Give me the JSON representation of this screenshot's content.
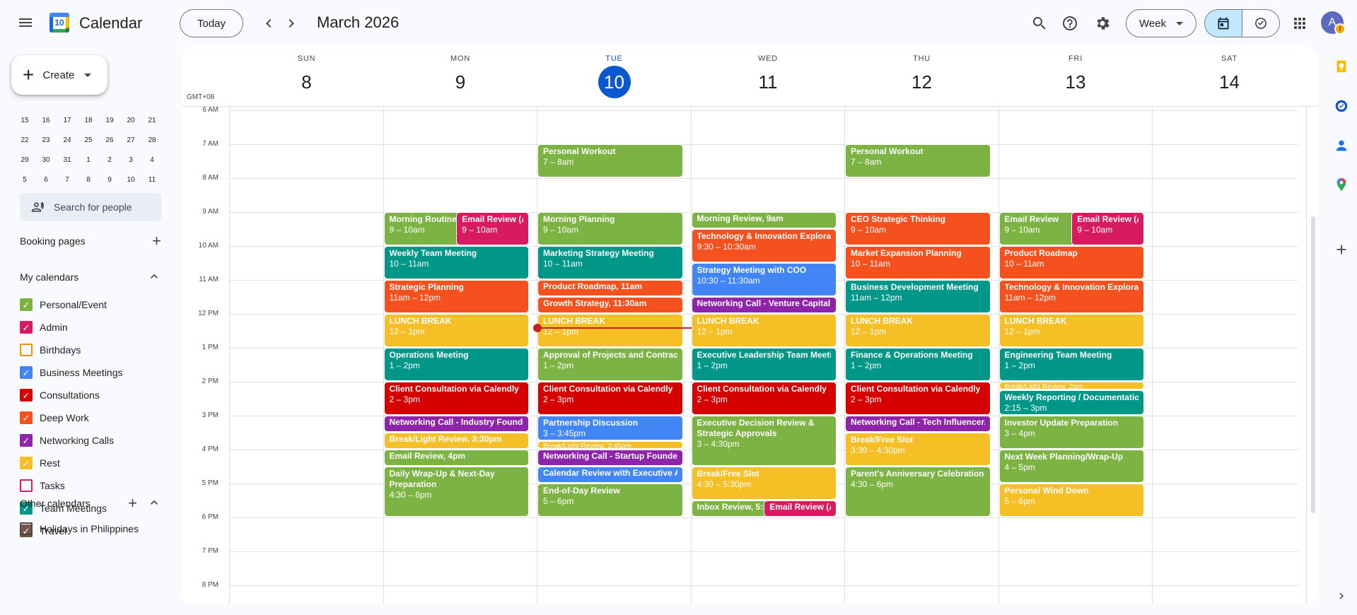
{
  "colors": {
    "lavender": "#7986cb",
    "green": "#7cb342",
    "teal": "#039be5",
    "peacock": "#0b8043",
    "tomato": "#d50000",
    "tangerine": "#f4511e",
    "grape": "#8e24aa",
    "banana": "#f6bf26",
    "flamingo": "#d81b60",
    "blueberry": "#3f86f5",
    "basil": "#0d9488",
    "graphite": "#795548",
    "now": "#c5221f",
    "today": "#0b57d0"
  },
  "header": {
    "menu_icon": "menu-icon",
    "logo_date": "10",
    "app_title": "Calendar",
    "today_label": "Today",
    "prev_icon": "chevron-left-icon",
    "next_icon": "chevron-right-icon",
    "month_title": "March 2026",
    "view_label": "Week",
    "avatar_letter": "A",
    "avatar_badge": "!"
  },
  "sidebar": {
    "create_label": "Create",
    "minical_rows": [
      [
        "15",
        "16",
        "17",
        "18",
        "19",
        "20",
        "21"
      ],
      [
        "22",
        "23",
        "24",
        "25",
        "26",
        "27",
        "28"
      ],
      [
        "29",
        "30",
        "31",
        "1",
        "2",
        "3",
        "4"
      ],
      [
        "5",
        "6",
        "7",
        "8",
        "9",
        "10",
        "11"
      ]
    ],
    "people_search_placeholder": "Search for people",
    "booking_pages_label": "Booking pages",
    "my_calendars_label": "My calendars",
    "my_calendars": [
      {
        "label": "Personal/Event",
        "color": "#7cb342",
        "checked": true
      },
      {
        "label": "Admin",
        "color": "#d81b60",
        "checked": true
      },
      {
        "label": "Birthdays",
        "color": "#f09300",
        "checked": false
      },
      {
        "label": "Business Meetings",
        "color": "#4285f4",
        "checked": true
      },
      {
        "label": "Consultations",
        "color": "#d50000",
        "checked": true
      },
      {
        "label": "Deep Work",
        "color": "#f4511e",
        "checked": true
      },
      {
        "label": "Networking Calls",
        "color": "#8e24aa",
        "checked": true
      },
      {
        "label": "Rest",
        "color": "#f6bf26",
        "checked": true
      },
      {
        "label": "Tasks",
        "color": "#d81b60",
        "checked": false
      },
      {
        "label": "Team Meetings",
        "color": "#009688",
        "checked": true
      },
      {
        "label": "Travel",
        "color": "#795548",
        "checked": true
      }
    ],
    "other_calendars_label": "Other calendars",
    "other_calendars": [
      {
        "label": "Holidays in Philippines",
        "color": "#444746",
        "checked": false
      }
    ]
  },
  "week": {
    "timezone": "GMT+08",
    "days": [
      {
        "dow": "SUN",
        "num": "8",
        "today": false
      },
      {
        "dow": "MON",
        "num": "9",
        "today": false
      },
      {
        "dow": "TUE",
        "num": "10",
        "today": true
      },
      {
        "dow": "WED",
        "num": "11",
        "today": false
      },
      {
        "dow": "THU",
        "num": "12",
        "today": false
      },
      {
        "dow": "FRI",
        "num": "13",
        "today": false
      },
      {
        "dow": "SAT",
        "num": "14",
        "today": false
      }
    ],
    "hours": [
      "6 AM",
      "7 AM",
      "8 AM",
      "9 AM",
      "10 AM",
      "11 AM",
      "12 PM",
      "1 PM",
      "2 PM",
      "3 PM",
      "4 PM",
      "5 PM",
      "6 PM",
      "7 PM",
      "8 PM"
    ],
    "now_time": "12:25"
  },
  "events": [
    {
      "day": 2,
      "start": 7,
      "end": 8,
      "title": "Personal Workout",
      "time": "7 – 8am",
      "color": "#7cb342"
    },
    {
      "day": 4,
      "start": 7,
      "end": 8,
      "title": "Personal Workout",
      "time": "7 – 8am",
      "color": "#7cb342"
    },
    {
      "day": 1,
      "start": 9,
      "end": 10,
      "title": "Morning Routine",
      "time": "9 – 10am",
      "color": "#7cb342",
      "col": 0,
      "cols": 2
    },
    {
      "day": 1,
      "start": 9,
      "end": 10,
      "title": "Email Review (Ad",
      "time": "9 – 10am",
      "color": "#d81b60",
      "col": 1,
      "cols": 2,
      "overlap": true
    },
    {
      "day": 1,
      "start": 10,
      "end": 11,
      "title": "Weekly Team Meeting",
      "time": "10 – 11am",
      "color": "#009688"
    },
    {
      "day": 1,
      "start": 11,
      "end": 12,
      "title": "Strategic Planning",
      "time": "11am – 12pm",
      "color": "#f4511e"
    },
    {
      "day": 1,
      "start": 12,
      "end": 13,
      "title": "LUNCH BREAK",
      "time": "12 – 1pm",
      "color": "#f6bf26"
    },
    {
      "day": 1,
      "start": 13,
      "end": 14,
      "title": "Operations Meeting",
      "time": "1 – 2pm",
      "color": "#009688"
    },
    {
      "day": 1,
      "start": 14,
      "end": 15,
      "title": "Client Consultation via Calendly",
      "time": "2 – 3pm",
      "color": "#d50000"
    },
    {
      "day": 1,
      "start": 15,
      "end": 15.5,
      "title": "Networking Call - Industry Founder",
      "time": "",
      "color": "#8e24aa"
    },
    {
      "day": 1,
      "start": 15.5,
      "end": 16,
      "title": "Break/Light Review, 3:30pm",
      "time": "",
      "color": "#f6bf26"
    },
    {
      "day": 1,
      "start": 16,
      "end": 16.5,
      "title": "Email Review, 4pm",
      "time": "",
      "color": "#7cb342"
    },
    {
      "day": 1,
      "start": 16.5,
      "end": 18,
      "title": "Daily Wrap-Up & Next-Day Preparation",
      "time": "4:30 – 6pm",
      "color": "#7cb342",
      "wrap": true
    },
    {
      "day": 2,
      "start": 9,
      "end": 10,
      "title": "Morning Planning",
      "time": "9 – 10am",
      "color": "#7cb342"
    },
    {
      "day": 2,
      "start": 10,
      "end": 11,
      "title": "Marketing Strategy Meeting",
      "time": "10 – 11am",
      "color": "#009688"
    },
    {
      "day": 2,
      "start": 11,
      "end": 11.5,
      "title": "Product Roadmap, 11am",
      "time": "",
      "color": "#f4511e"
    },
    {
      "day": 2,
      "start": 11.5,
      "end": 12,
      "title": "Growth Strategy, 11:30am",
      "time": "",
      "color": "#f4511e"
    },
    {
      "day": 2,
      "start": 12,
      "end": 13,
      "title": "LUNCH BREAK",
      "time": "12 – 1pm",
      "color": "#f6bf26"
    },
    {
      "day": 2,
      "start": 13,
      "end": 14,
      "title": "Approval of Projects and Contracts",
      "time": "1 – 2pm",
      "color": "#7cb342"
    },
    {
      "day": 2,
      "start": 14,
      "end": 15,
      "title": "Client Consultation via Calendly",
      "time": "2 – 3pm",
      "color": "#d50000"
    },
    {
      "day": 2,
      "start": 15,
      "end": 15.75,
      "title": "Partnership Discussion",
      "time": "3 – 3:45pm",
      "color": "#4285f4"
    },
    {
      "day": 2,
      "start": 15.75,
      "end": 16,
      "title": "Break/Light Review, 3:45pm",
      "time": "",
      "color": "#f6bf26",
      "small": true
    },
    {
      "day": 2,
      "start": 16,
      "end": 16.5,
      "title": "Networking Call - Startup Founder",
      "time": "",
      "color": "#8e24aa"
    },
    {
      "day": 2,
      "start": 16.5,
      "end": 17,
      "title": "Calendar Review with Executive As",
      "time": "",
      "color": "#4285f4"
    },
    {
      "day": 2,
      "start": 17,
      "end": 18,
      "title": "End-of-Day Review",
      "time": "5 – 6pm",
      "color": "#7cb342"
    },
    {
      "day": 3,
      "start": 9,
      "end": 9.5,
      "title": "Morning Review, 9am",
      "time": "",
      "color": "#7cb342"
    },
    {
      "day": 3,
      "start": 9.5,
      "end": 10.5,
      "title": "Technology & Innovation Exploratio",
      "time": "9:30 – 10:30am",
      "color": "#f4511e"
    },
    {
      "day": 3,
      "start": 10.5,
      "end": 11.5,
      "title": "Strategy Meeting with COO",
      "time": "10:30 – 11:30am",
      "color": "#4285f4"
    },
    {
      "day": 3,
      "start": 11.5,
      "end": 12,
      "title": "Networking Call - Venture Capital G",
      "time": "",
      "color": "#8e24aa"
    },
    {
      "day": 3,
      "start": 12,
      "end": 13,
      "title": "LUNCH BREAK",
      "time": "12 – 1pm",
      "color": "#f6bf26"
    },
    {
      "day": 3,
      "start": 13,
      "end": 14,
      "title": "Executive Leadership Team Meetin",
      "time": "1 – 2pm",
      "color": "#009688"
    },
    {
      "day": 3,
      "start": 14,
      "end": 15,
      "title": "Client Consultation via Calendly",
      "time": "2 – 3pm",
      "color": "#d50000"
    },
    {
      "day": 3,
      "start": 15,
      "end": 16.5,
      "title": "Executive Decision Review & Strategic Approvals",
      "time": "3 – 4:30pm",
      "color": "#7cb342",
      "wrap": true
    },
    {
      "day": 3,
      "start": 16.5,
      "end": 17.5,
      "title": "Break/Free Slot",
      "time": "4:30 – 5:30pm",
      "color": "#f6bf26"
    },
    {
      "day": 3,
      "start": 17.5,
      "end": 18,
      "title": "Inbox Review, 5:3",
      "time": "",
      "color": "#7cb342",
      "col": 0,
      "cols": 2
    },
    {
      "day": 3,
      "start": 17.5,
      "end": 18,
      "title": "Email Review (Ad",
      "time": "",
      "color": "#d81b60",
      "col": 1,
      "cols": 2,
      "overlap": true
    },
    {
      "day": 4,
      "start": 9,
      "end": 10,
      "title": "CEO Strategic Thinking",
      "time": "9 – 10am",
      "color": "#f4511e"
    },
    {
      "day": 4,
      "start": 10,
      "end": 11,
      "title": "Market Expansion Planning",
      "time": "10 – 11am",
      "color": "#f4511e"
    },
    {
      "day": 4,
      "start": 11,
      "end": 12,
      "title": "Business Development Meeting",
      "time": "11am – 12pm",
      "color": "#009688"
    },
    {
      "day": 4,
      "start": 12,
      "end": 13,
      "title": "LUNCH BREAK",
      "time": "12 – 1pm",
      "color": "#f6bf26"
    },
    {
      "day": 4,
      "start": 13,
      "end": 14,
      "title": "Finance & Operations Meeting",
      "time": "1 – 2pm",
      "color": "#009688"
    },
    {
      "day": 4,
      "start": 14,
      "end": 15,
      "title": "Client Consultation via Calendly",
      "time": "2 – 3pm",
      "color": "#d50000"
    },
    {
      "day": 4,
      "start": 15,
      "end": 15.5,
      "title": "Networking Call - Tech Influencer,",
      "time": "",
      "color": "#8e24aa"
    },
    {
      "day": 4,
      "start": 15.5,
      "end": 16.5,
      "title": "Break/Free Slot",
      "time": "3:30 – 4:30pm",
      "color": "#f6bf26"
    },
    {
      "day": 4,
      "start": 16.5,
      "end": 18,
      "title": "Parent's Anniversary Celebration",
      "time": "4:30 – 6pm",
      "color": "#7cb342"
    },
    {
      "day": 5,
      "start": 9,
      "end": 10,
      "title": "Email Review",
      "time": "9 – 10am",
      "color": "#7cb342",
      "col": 0,
      "cols": 2
    },
    {
      "day": 5,
      "start": 9,
      "end": 10,
      "title": "Email Review (Ac",
      "time": "9 – 10am",
      "color": "#d81b60",
      "col": 1,
      "cols": 2,
      "overlap": true
    },
    {
      "day": 5,
      "start": 10,
      "end": 11,
      "title": "Product Roadmap",
      "time": "10 – 11am",
      "color": "#f4511e"
    },
    {
      "day": 5,
      "start": 11,
      "end": 12,
      "title": "Technology & Innovation Exploratio",
      "time": "11am – 12pm",
      "color": "#f4511e"
    },
    {
      "day": 5,
      "start": 12,
      "end": 13,
      "title": "LUNCH BREAK",
      "time": "12 – 1pm",
      "color": "#f6bf26"
    },
    {
      "day": 5,
      "start": 13,
      "end": 14,
      "title": "Engineering Team Meeting",
      "time": "1 – 2pm",
      "color": "#009688"
    },
    {
      "day": 5,
      "start": 14,
      "end": 14.25,
      "title": "Break/Light Review, 2pm",
      "time": "",
      "color": "#f6bf26",
      "small": true
    },
    {
      "day": 5,
      "start": 14.25,
      "end": 15,
      "title": "Weekly Reporting / Documentation",
      "time": "2:15 – 3pm",
      "color": "#009688"
    },
    {
      "day": 5,
      "start": 15,
      "end": 16,
      "title": "Investor Update Preparation",
      "time": "3 – 4pm",
      "color": "#7cb342"
    },
    {
      "day": 5,
      "start": 16,
      "end": 17,
      "title": "Next Week Planning/Wrap-Up",
      "time": "4 – 5pm",
      "color": "#7cb342"
    },
    {
      "day": 5,
      "start": 17,
      "end": 18,
      "title": "Personal Wind Down",
      "time": "5 – 6pm",
      "color": "#f6bf26"
    }
  ],
  "right_rail": [
    "keep-icon",
    "tasks-icon",
    "contacts-icon",
    "maps-icon",
    "add-addon-icon",
    "expand-icon"
  ]
}
